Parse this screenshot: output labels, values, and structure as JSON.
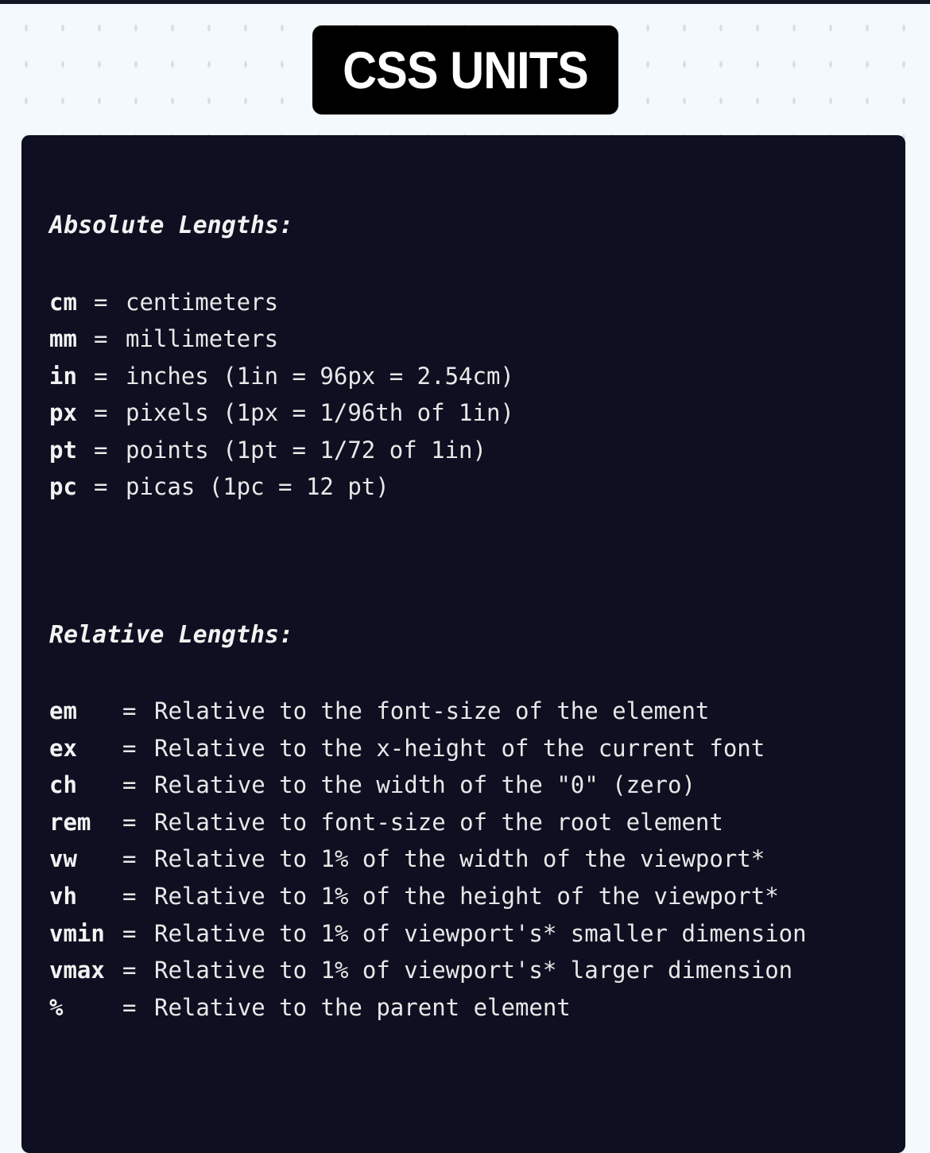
{
  "title": "CSS UNITS",
  "absolute": {
    "heading": "Absolute Lengths:",
    "items": [
      {
        "unit": "cm",
        "desc": "centimeters"
      },
      {
        "unit": "mm",
        "desc": "millimeters"
      },
      {
        "unit": "in",
        "desc": "inches (1in = 96px = 2.54cm)"
      },
      {
        "unit": "px",
        "desc": "pixels (1px = 1/96th of 1in)"
      },
      {
        "unit": "pt",
        "desc": "points (1pt = 1/72 of 1in)"
      },
      {
        "unit": "pc",
        "desc": "picas (1pc = 12 pt)"
      }
    ]
  },
  "relative": {
    "heading": "Relative Lengths:",
    "items": [
      {
        "unit": "em",
        "desc": "Relative to the font-size of the element"
      },
      {
        "unit": "ex",
        "desc": "Relative to the x-height of the current font"
      },
      {
        "unit": "ch",
        "desc": "Relative to the width of the \"0\" (zero)"
      },
      {
        "unit": "rem",
        "desc": "Relative to font-size of the root element"
      },
      {
        "unit": "vw",
        "desc": "Relative to 1% of the width of the viewport*"
      },
      {
        "unit": "vh",
        "desc": "Relative to 1% of the height of the viewport*"
      },
      {
        "unit": "vmin",
        "desc": "Relative to 1% of viewport's* smaller dimension"
      },
      {
        "unit": "vmax",
        "desc": "Relative to 1% of viewport's* larger dimension"
      },
      {
        "unit": "%",
        "desc": "Relative to the parent element"
      }
    ]
  },
  "equals": "="
}
